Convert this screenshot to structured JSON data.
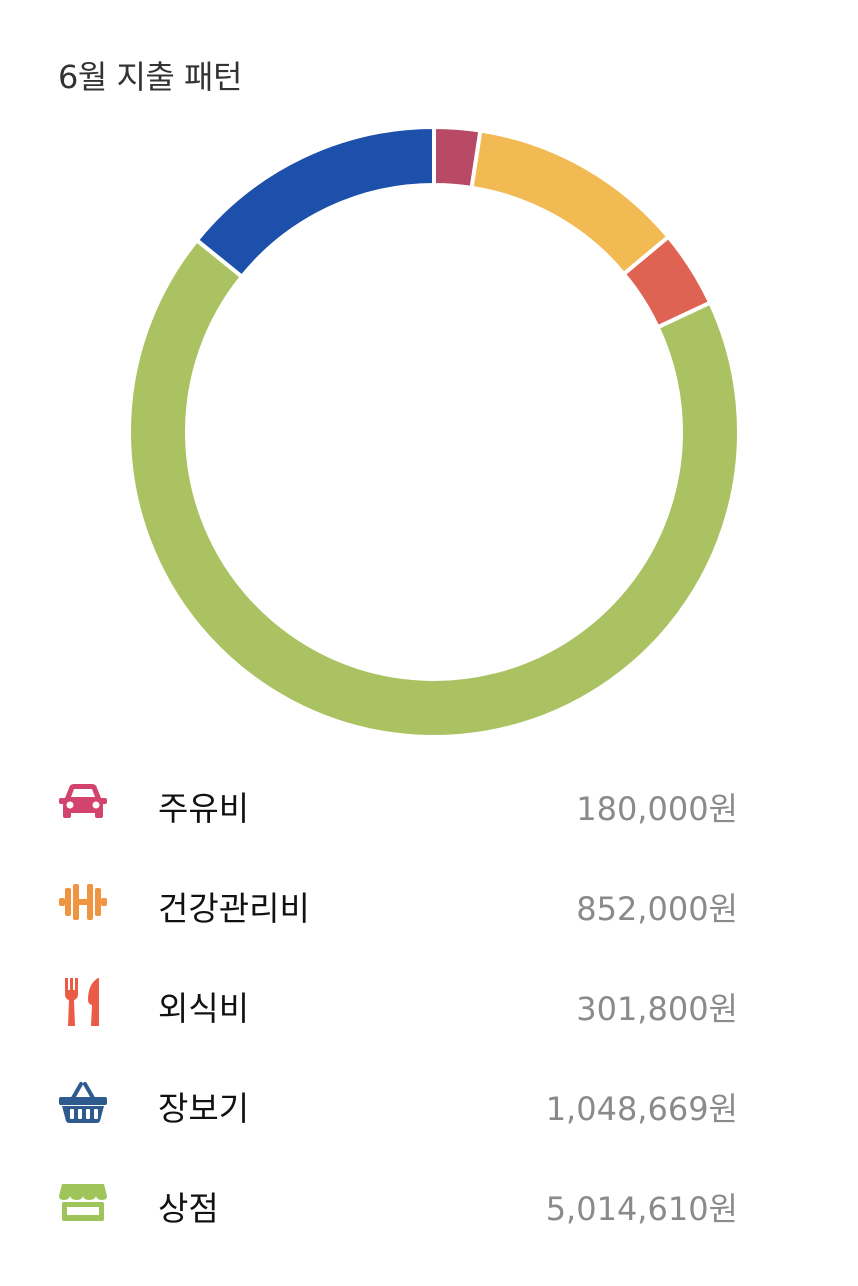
{
  "title": "6월 지출 패턴",
  "chart_data": {
    "type": "pie",
    "title": "6월 지출 패턴",
    "categories": [
      "주유비",
      "건강관리비",
      "외식비",
      "장보기",
      "상점"
    ],
    "values": [
      180000,
      852000,
      301800,
      1048669,
      5014610
    ],
    "colors": [
      "#B84A66",
      "#F2BA52",
      "#DE6352",
      "#1C50AB",
      "#ABC263"
    ],
    "slice_order": [
      0,
      1,
      2,
      3,
      4
    ],
    "display_order": [
      0,
      1,
      2,
      4,
      3
    ]
  },
  "legend": [
    {
      "label": "주유비",
      "amount": "180,000원",
      "icon": "car-icon",
      "color": "#D2436E"
    },
    {
      "label": "건강관리비",
      "amount": "852,000원",
      "icon": "dumbbell-icon",
      "color": "#EF9440"
    },
    {
      "label": "외식비",
      "amount": "301,800원",
      "icon": "fork-knife-icon",
      "color": "#EC5B45"
    },
    {
      "label": "장보기",
      "amount": "1,048,669원",
      "icon": "basket-icon",
      "color": "#2E5A8E"
    },
    {
      "label": "상점",
      "amount": "5,014,610원",
      "icon": "store-icon",
      "color": "#9FC55A"
    }
  ]
}
